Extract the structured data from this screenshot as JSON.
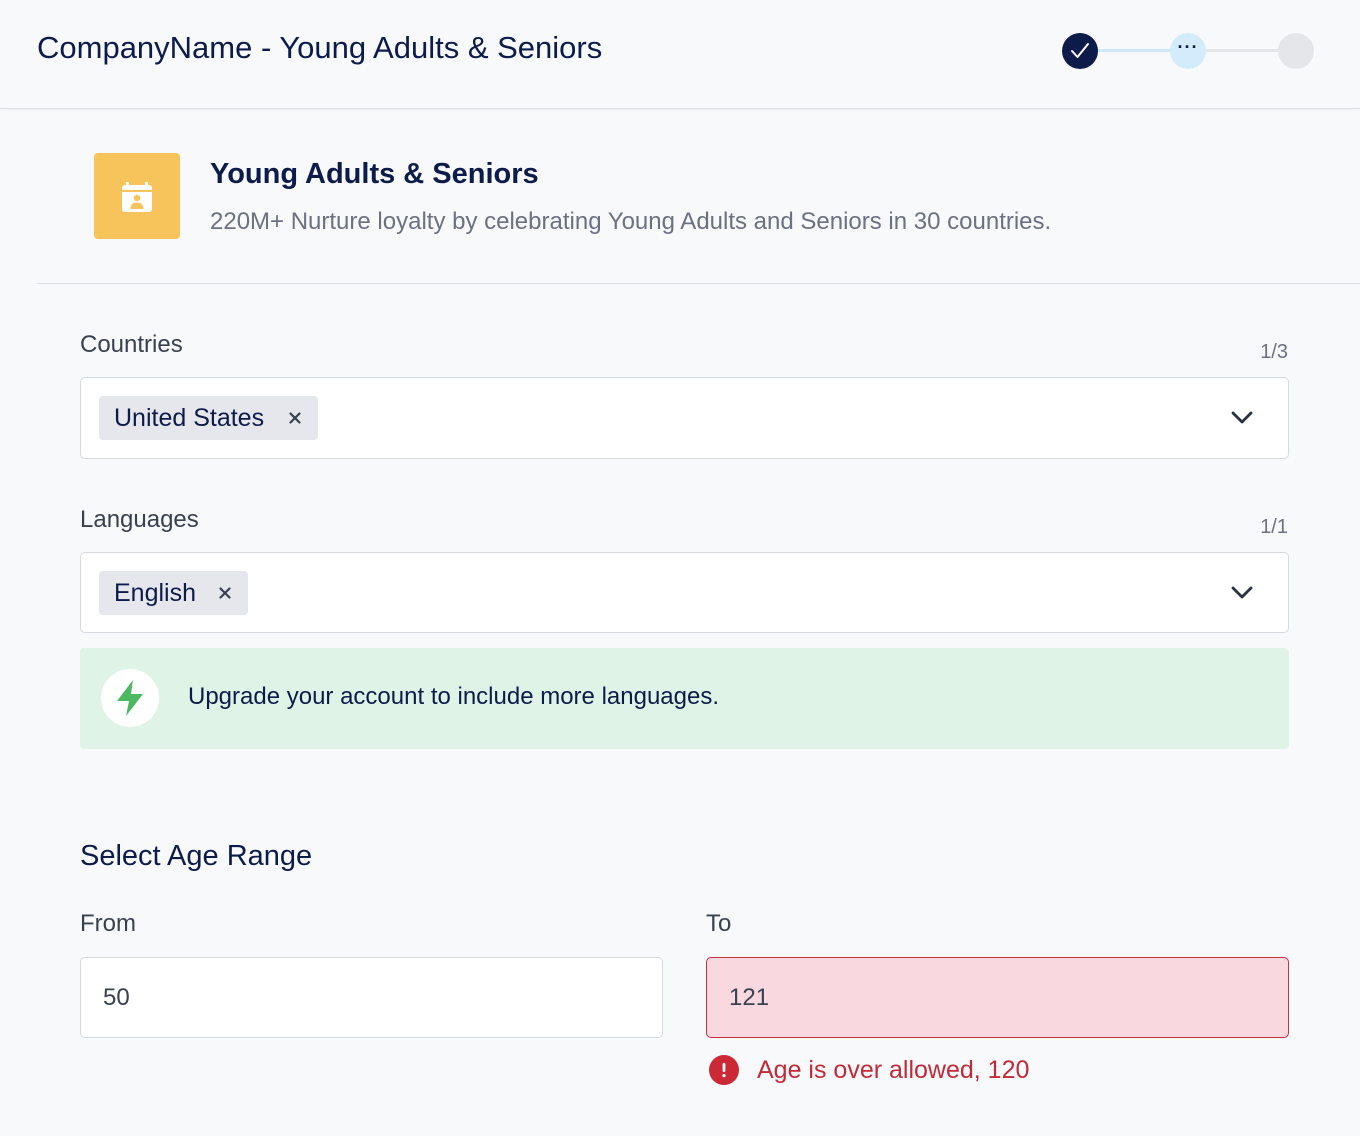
{
  "header": {
    "title": "CompanyName - Young Adults & Seniors",
    "stepper": {
      "steps": [
        {
          "state": "completed",
          "icon": "check-icon"
        },
        {
          "state": "current",
          "label": "···"
        },
        {
          "state": "upcoming"
        }
      ]
    }
  },
  "segment": {
    "icon": "calendar-person-icon",
    "icon_color": "#f6c45b",
    "title": "Young Adults & Seniors",
    "description": "220M+ Nurture loyalty by celebrating Young Adults and Seniors in 30 countries."
  },
  "countries": {
    "label": "Countries",
    "counter": "1/3",
    "selected": [
      "United States"
    ]
  },
  "languages": {
    "label": "Languages",
    "counter": "1/1",
    "selected": [
      "English"
    ]
  },
  "upgrade_banner": {
    "icon": "lightning-bolt-icon",
    "text": "Upgrade your account to include more languages."
  },
  "age_range": {
    "title": "Select Age Range",
    "from": {
      "label": "From",
      "value": "50"
    },
    "to": {
      "label": "To",
      "value": "121"
    },
    "error": "Age is over allowed, 120"
  },
  "colors": {
    "primary": "#0d1b4a",
    "error": "#cc2937",
    "success_bg": "#dff4e7",
    "bolt": "#4cb861"
  }
}
